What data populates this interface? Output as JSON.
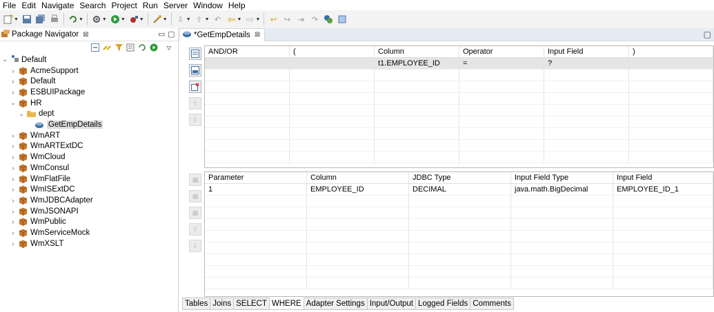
{
  "menu": [
    "File",
    "Edit",
    "Navigate",
    "Search",
    "Project",
    "Run",
    "Server",
    "Window",
    "Help"
  ],
  "navigator": {
    "title": "Package Navigator",
    "close_glyph": "⊠",
    "root": "Default",
    "items": [
      "AcmeSupport",
      "Default",
      "ESBUIPackage",
      "HR",
      "dept",
      "GetEmpDetails",
      "WmART",
      "WmARTExtDC",
      "WmCloud",
      "WmConsul",
      "WmFlatFile",
      "WmISExtDC",
      "WmJDBCAdapter",
      "WmJSONAPI",
      "WmPublic",
      "WmServiceMock",
      "WmXSLT"
    ]
  },
  "editor": {
    "tab_title": "*GetEmpDetails",
    "close_glyph": "⊠",
    "where_grid": {
      "headers": [
        "AND/OR",
        "(",
        "Column",
        "Operator",
        "Input Field",
        ")"
      ],
      "rows": [
        [
          "",
          "",
          "t1.EMPLOYEE_ID",
          "=",
          "?",
          ""
        ]
      ]
    },
    "param_grid": {
      "headers": [
        "Parameter",
        "Column",
        "JDBC Type",
        "Input Field Type",
        "Input Field"
      ],
      "rows": [
        [
          "1",
          "EMPLOYEE_ID",
          "DECIMAL",
          "java.math.BigDecimal",
          "EMPLOYEE_ID_1"
        ]
      ]
    },
    "bottom_tabs": [
      "Tables",
      "Joins",
      "SELECT",
      "WHERE",
      "Adapter Settings",
      "Input/Output",
      "Logged Fields",
      "Comments"
    ],
    "active_bottom_tab": "WHERE"
  },
  "icons": {
    "package_color": "#c7772b",
    "folder_color": "#e8b84a",
    "service_color": "#3a6ea5"
  }
}
